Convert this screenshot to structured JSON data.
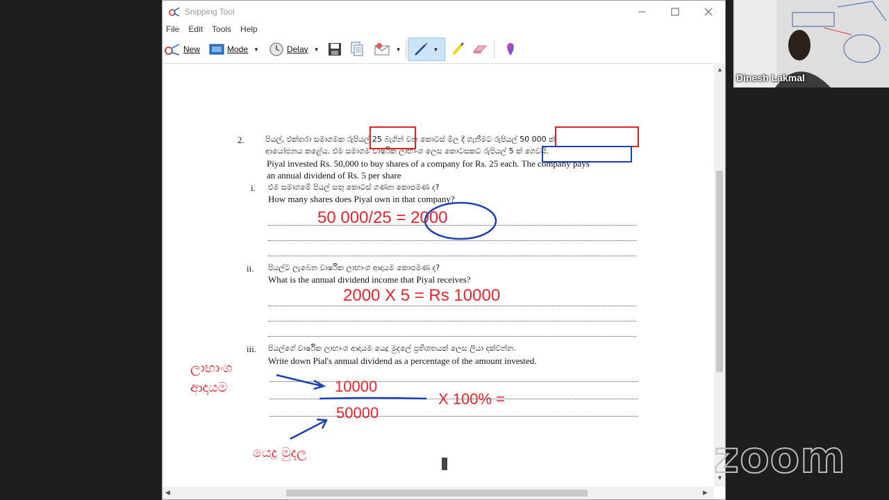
{
  "window": {
    "title": "Snipping Tool",
    "menu": [
      "File",
      "Edit",
      "Tools",
      "Help"
    ],
    "toolbar": {
      "new_label": "New",
      "mode_label": "Mode",
      "delay_label": "Delay"
    }
  },
  "document": {
    "q_number": "2.",
    "sinhala_line1": "පියල්, එක්තරා සමාගමක රුපියල් 25 බැගින් වන කොටස් මිල දී ගැනීමට රුපියල් 50 000 ක්",
    "sinhala_line2": "ආයෝජනය කළේය. එම සමාගම වාර්ෂික ලාභාංශ ලෙස කොටසකට රුපියල් 5 ක් ගෙවයි.",
    "english_line1": "Piyal invested Rs. 50,000 to buy shares of a company for Rs. 25 each. The company pays",
    "english_line2": "an annual dividend of Rs. 5 per share",
    "parts": [
      {
        "num": "i.",
        "sinhala": "එම සමාගමේ පියල් සතු කොටස් ගණන කොපමණ ද?",
        "english": "How many shares does Piyal own in that company?"
      },
      {
        "num": "ii.",
        "sinhala": "පියල්ට ලැබෙන වාර්ෂික ලාභාංශ ආදායම කොපමණ ද?",
        "english": "What is the annual dividend income that Piyal receives?"
      },
      {
        "num": "iii.",
        "sinhala": "පියල්ගේ වාර්ෂික ලාභාංශ ආදායම යෙදූ මුදලේ ප්‍රතිශතයක් ලෙස ලියා දක්වන්න.",
        "english": "Write down Pial's annual dividend as a percentage of the amount invested."
      }
    ]
  },
  "annotations": {
    "answer1": "50 000/25 = 2000",
    "answer2": "2000 X 5 = Rs 10000",
    "numerator": "10000",
    "denominator": "50000",
    "times100": "X 100% =",
    "label_dividend_line1": "ලාභාංශ",
    "label_dividend_line2": "ආදායම",
    "label_investment": "යෙදූ මුදල"
  },
  "participant": {
    "name": "Dinesh Lakmal"
  },
  "zoom_logo": "zoom"
}
